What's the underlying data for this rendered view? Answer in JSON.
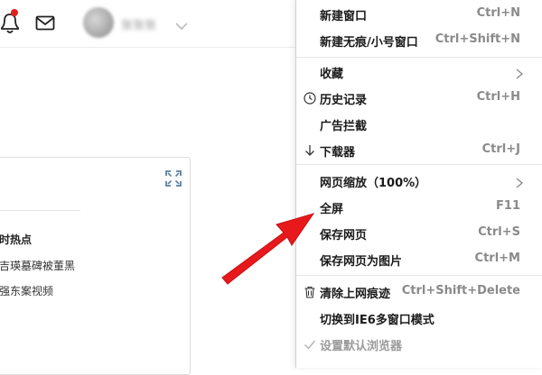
{
  "header": {
    "username": "张张张",
    "icons": [
      "bell-icon",
      "mail-icon",
      "chevron-down-icon"
    ],
    "notification_color": "#e0201c"
  },
  "panel": {
    "section_title": "时热点",
    "items": [
      "吉瑛墓碑被董黑",
      "强东案视频"
    ]
  },
  "menu": {
    "groups": [
      [
        {
          "label": "新建窗口",
          "shortcut": "Ctrl+N"
        },
        {
          "label": "新建无痕/小号窗口",
          "shortcut": "Ctrl+Shift+N"
        }
      ],
      [
        {
          "label": "收藏",
          "shortcut": "",
          "submenu": true
        },
        {
          "label": "历史记录",
          "shortcut": "Ctrl+H",
          "icon": "clock-icon"
        },
        {
          "label": "广告拦截",
          "shortcut": ""
        },
        {
          "label": "下载器",
          "shortcut": "Ctrl+J",
          "icon": "download-arrow-icon"
        }
      ],
      [
        {
          "label": "网页缩放（100%）",
          "shortcut": "",
          "submenu": true
        },
        {
          "label": "全屏",
          "shortcut": "F11"
        },
        {
          "label": "保存网页",
          "shortcut": "Ctrl+S"
        },
        {
          "label": "保存网页为图片",
          "shortcut": "Ctrl+M"
        }
      ],
      [
        {
          "label": "清除上网痕迹",
          "shortcut": "Ctrl+Shift+Delete",
          "icon": "trash-icon"
        },
        {
          "label": "切换到IE6多窗口模式",
          "shortcut": ""
        },
        {
          "label": "设置默认浏览器",
          "shortcut": "",
          "icon": "check-icon",
          "disabled": true
        }
      ]
    ]
  },
  "annotation": {
    "arrow_color": "#e8191c",
    "arrow_target": "全屏"
  }
}
